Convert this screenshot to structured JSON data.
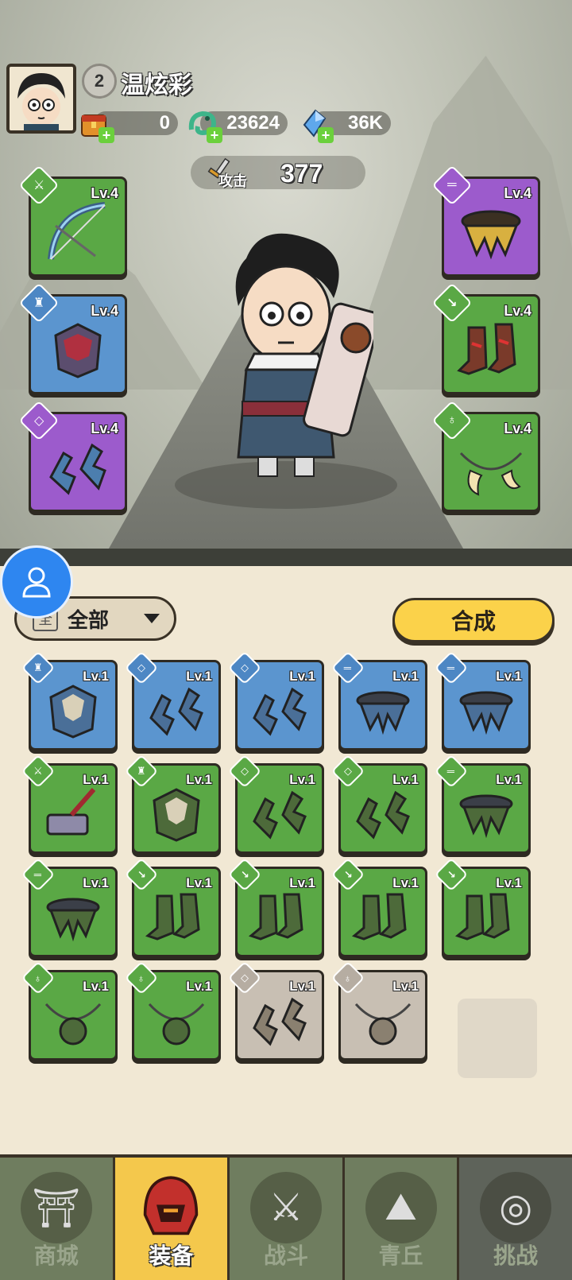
{
  "player": {
    "level": "2",
    "name": "温炫彩"
  },
  "resources": [
    {
      "icon": "treasure-chest-icon",
      "value": "0"
    },
    {
      "icon": "jade-dragon-icon",
      "value": "23624"
    },
    {
      "icon": "blue-crystal-icon",
      "value": "36K"
    }
  ],
  "stats": {
    "attack_label": "攻击",
    "attack_value": "377"
  },
  "equipped": {
    "left": [
      {
        "type": "weapon",
        "rarity": "green",
        "level": "Lv.4",
        "item": "bow"
      },
      {
        "type": "armor",
        "rarity": "blue",
        "level": "Lv.4",
        "item": "armor"
      },
      {
        "type": "bracer",
        "rarity": "purple",
        "level": "Lv.4",
        "item": "bracers"
      }
    ],
    "right": [
      {
        "type": "belt",
        "rarity": "purple",
        "level": "Lv.4",
        "item": "belt"
      },
      {
        "type": "boots",
        "rarity": "green",
        "level": "Lv.4",
        "item": "boots"
      },
      {
        "type": "necklace",
        "rarity": "green",
        "level": "Lv.4",
        "item": "necklace"
      }
    ]
  },
  "filter": {
    "icon_char": "全",
    "label": "全部"
  },
  "merge_button": "合成",
  "inventory": [
    {
      "type": "armor",
      "rarity": "blue",
      "level": "Lv.1",
      "item": "gold-armor"
    },
    {
      "type": "bracer",
      "rarity": "blue",
      "level": "Lv.1",
      "item": "bracers"
    },
    {
      "type": "bracer",
      "rarity": "blue",
      "level": "Lv.1",
      "item": "fur-bracers"
    },
    {
      "type": "belt",
      "rarity": "blue",
      "level": "Lv.1",
      "item": "belt"
    },
    {
      "type": "belt",
      "rarity": "blue",
      "level": "Lv.1",
      "item": "dark-belt"
    },
    {
      "type": "weapon",
      "rarity": "green",
      "level": "Lv.1",
      "item": "hammer"
    },
    {
      "type": "armor",
      "rarity": "green",
      "level": "Lv.1",
      "item": "spike-armor"
    },
    {
      "type": "bracer",
      "rarity": "green",
      "level": "Lv.1",
      "item": "bracers"
    },
    {
      "type": "bracer",
      "rarity": "green",
      "level": "Lv.1",
      "item": "red-bracers"
    },
    {
      "type": "belt",
      "rarity": "green",
      "level": "Lv.1",
      "item": "belt"
    },
    {
      "type": "belt",
      "rarity": "green",
      "level": "Lv.1",
      "item": "belt"
    },
    {
      "type": "boots",
      "rarity": "green",
      "level": "Lv.1",
      "item": "dark-boots"
    },
    {
      "type": "boots",
      "rarity": "green",
      "level": "Lv.1",
      "item": "dark-boots"
    },
    {
      "type": "boots",
      "rarity": "green",
      "level": "Lv.1",
      "item": "gold-boots"
    },
    {
      "type": "boots",
      "rarity": "green",
      "level": "Lv.1",
      "item": "gold-boots"
    },
    {
      "type": "necklace",
      "rarity": "green",
      "level": "Lv.1",
      "item": "flower-necklace"
    },
    {
      "type": "necklace",
      "rarity": "green",
      "level": "Lv.1",
      "item": "crystal-necklace"
    },
    {
      "type": "bracer",
      "rarity": "gray",
      "level": "Lv.1",
      "item": "fur-bracers"
    },
    {
      "type": "necklace",
      "rarity": "gray",
      "level": "Lv.1",
      "item": "tooth-necklace"
    }
  ],
  "nav": [
    {
      "label": "商城",
      "icon": "shop-icon",
      "active": false
    },
    {
      "label": "装备",
      "icon": "helmet-icon",
      "active": true
    },
    {
      "label": "战斗",
      "icon": "crossed-swords-icon",
      "active": false
    },
    {
      "label": "青丘",
      "icon": "mountain-icon",
      "active": false
    },
    {
      "label": "挑战",
      "icon": "challenge-orb-icon",
      "active": false
    }
  ]
}
